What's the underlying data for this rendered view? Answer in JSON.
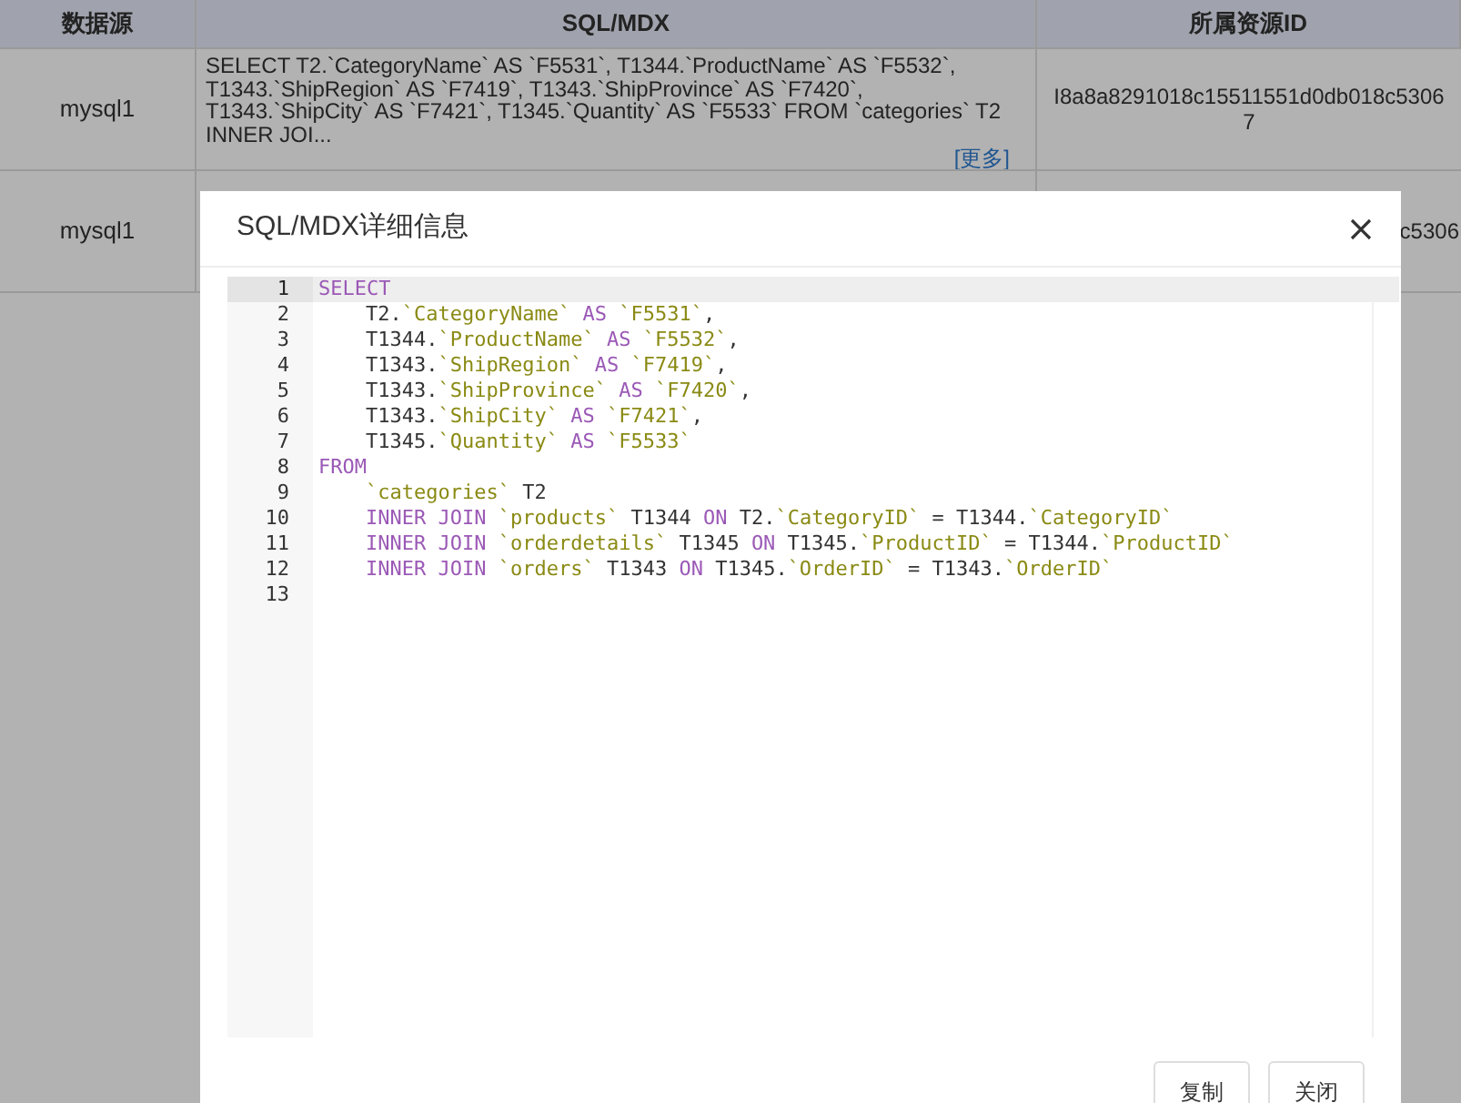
{
  "table": {
    "columns": [
      "数据源",
      "SQL/MDX",
      "所属资源ID"
    ],
    "rows": [
      {
        "source": "mysql1",
        "sql": "SELECT T2.`CategoryName` AS `F5531`, T1344.`ProductName` AS `F5532`, T1343.`ShipRegion` AS `F7419`, T1343.`ShipProvince` AS `F7420`, T1343.`ShipCity` AS `F7421`, T1345.`Quantity` AS `F5533` FROM `categories` T2 INNER JOI...",
        "more_link": "[更多]",
        "resource_id": "I8a8a8291018c15511551d0db018c53067"
      },
      {
        "source": "mysql1",
        "resource_id": "c5306"
      }
    ]
  },
  "dialog": {
    "title": "SQL/MDX详细信息",
    "lines": [
      {
        "number": "1",
        "active": true,
        "indented": false,
        "tokens": [
          {
            "kind": "keyword",
            "text": "SELECT"
          }
        ]
      },
      {
        "number": "2",
        "active": false,
        "indented": true,
        "tokens": [
          {
            "kind": "plain",
            "text": "T2."
          },
          {
            "kind": "identifier",
            "text": "`CategoryName`"
          },
          {
            "kind": "keyword",
            "text": " AS "
          },
          {
            "kind": "identifier",
            "text": "`F5531`"
          },
          {
            "kind": "plain",
            "text": ","
          }
        ]
      },
      {
        "number": "3",
        "active": false,
        "indented": true,
        "tokens": [
          {
            "kind": "plain",
            "text": "T1344."
          },
          {
            "kind": "identifier",
            "text": "`ProductName`"
          },
          {
            "kind": "keyword",
            "text": " AS "
          },
          {
            "kind": "identifier",
            "text": "`F5532`"
          },
          {
            "kind": "plain",
            "text": ","
          }
        ]
      },
      {
        "number": "4",
        "active": false,
        "indented": true,
        "tokens": [
          {
            "kind": "plain",
            "text": "T1343."
          },
          {
            "kind": "identifier",
            "text": "`ShipRegion`"
          },
          {
            "kind": "keyword",
            "text": " AS "
          },
          {
            "kind": "identifier",
            "text": "`F7419`"
          },
          {
            "kind": "plain",
            "text": ","
          }
        ]
      },
      {
        "number": "5",
        "active": false,
        "indented": true,
        "tokens": [
          {
            "kind": "plain",
            "text": "T1343."
          },
          {
            "kind": "identifier",
            "text": "`ShipProvince`"
          },
          {
            "kind": "keyword",
            "text": " AS "
          },
          {
            "kind": "identifier",
            "text": "`F7420`"
          },
          {
            "kind": "plain",
            "text": ","
          }
        ]
      },
      {
        "number": "6",
        "active": false,
        "indented": true,
        "tokens": [
          {
            "kind": "plain",
            "text": "T1343."
          },
          {
            "kind": "identifier",
            "text": "`ShipCity`"
          },
          {
            "kind": "keyword",
            "text": " AS "
          },
          {
            "kind": "identifier",
            "text": "`F7421`"
          },
          {
            "kind": "plain",
            "text": ","
          }
        ]
      },
      {
        "number": "7",
        "active": false,
        "indented": true,
        "tokens": [
          {
            "kind": "plain",
            "text": "T1345."
          },
          {
            "kind": "identifier",
            "text": "`Quantity`"
          },
          {
            "kind": "keyword",
            "text": " AS "
          },
          {
            "kind": "identifier",
            "text": "`F5533`"
          }
        ]
      },
      {
        "number": "8",
        "active": false,
        "indented": false,
        "tokens": [
          {
            "kind": "keyword",
            "text": "FROM"
          }
        ]
      },
      {
        "number": "9",
        "active": false,
        "indented": true,
        "tokens": [
          {
            "kind": "identifier",
            "text": "`categories`"
          },
          {
            "kind": "plain",
            "text": " T2"
          }
        ]
      },
      {
        "number": "10",
        "active": false,
        "indented": true,
        "tokens": [
          {
            "kind": "keyword",
            "text": "INNER JOIN "
          },
          {
            "kind": "identifier",
            "text": "`products`"
          },
          {
            "kind": "plain",
            "text": " T1344 "
          },
          {
            "kind": "keyword",
            "text": "ON"
          },
          {
            "kind": "plain",
            "text": " T2."
          },
          {
            "kind": "identifier",
            "text": "`CategoryID`"
          },
          {
            "kind": "plain",
            "text": " = T1344."
          },
          {
            "kind": "identifier",
            "text": "`CategoryID`"
          }
        ]
      },
      {
        "number": "11",
        "active": false,
        "indented": true,
        "tokens": [
          {
            "kind": "keyword",
            "text": "INNER JOIN "
          },
          {
            "kind": "identifier",
            "text": "`orderdetails`"
          },
          {
            "kind": "plain",
            "text": " T1345 "
          },
          {
            "kind": "keyword",
            "text": "ON"
          },
          {
            "kind": "plain",
            "text": " T1345."
          },
          {
            "kind": "identifier",
            "text": "`ProductID`"
          },
          {
            "kind": "plain",
            "text": " = T1344."
          },
          {
            "kind": "identifier",
            "text": "`ProductID`"
          }
        ]
      },
      {
        "number": "12",
        "active": false,
        "indented": true,
        "tokens": [
          {
            "kind": "keyword",
            "text": "INNER JOIN "
          },
          {
            "kind": "identifier",
            "text": "`orders`"
          },
          {
            "kind": "plain",
            "text": " T1343 "
          },
          {
            "kind": "keyword",
            "text": "ON"
          },
          {
            "kind": "plain",
            "text": " T1345."
          },
          {
            "kind": "identifier",
            "text": "`OrderID`"
          },
          {
            "kind": "plain",
            "text": " = T1343."
          },
          {
            "kind": "identifier",
            "text": "`OrderID`"
          }
        ]
      },
      {
        "number": "13",
        "active": false
      }
    ],
    "buttons": [
      "复制",
      "关闭"
    ]
  }
}
